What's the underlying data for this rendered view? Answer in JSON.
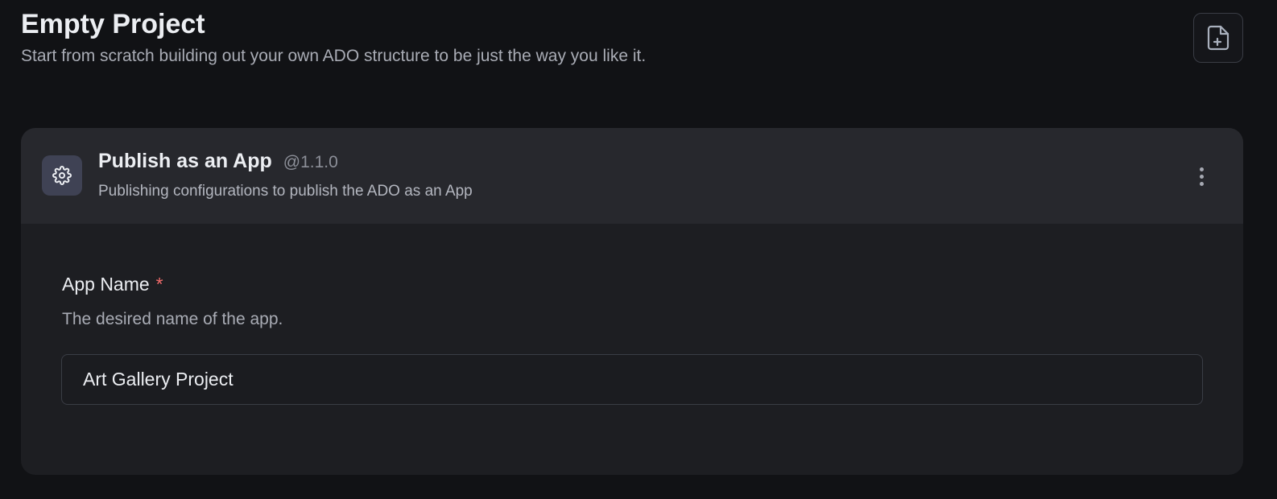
{
  "header": {
    "title": "Empty Project",
    "subtitle": "Start from scratch building out your own ADO structure to be just the way you like it.",
    "new_file_icon": "file-plus-icon"
  },
  "module": {
    "icon": "gear-icon",
    "title": "Publish as an App",
    "version": "@1.1.0",
    "description": "Publishing configurations to publish the ADO as an App",
    "menu_icon": "more-vertical-icon"
  },
  "form": {
    "app_name": {
      "label": "App Name",
      "required_mark": "*",
      "description": "The desired name of the app.",
      "value": "Art Gallery Project"
    }
  },
  "colors": {
    "background": "#111215",
    "card": "#1d1e22",
    "card_header": "#27282d",
    "required": "#f06a6a"
  }
}
